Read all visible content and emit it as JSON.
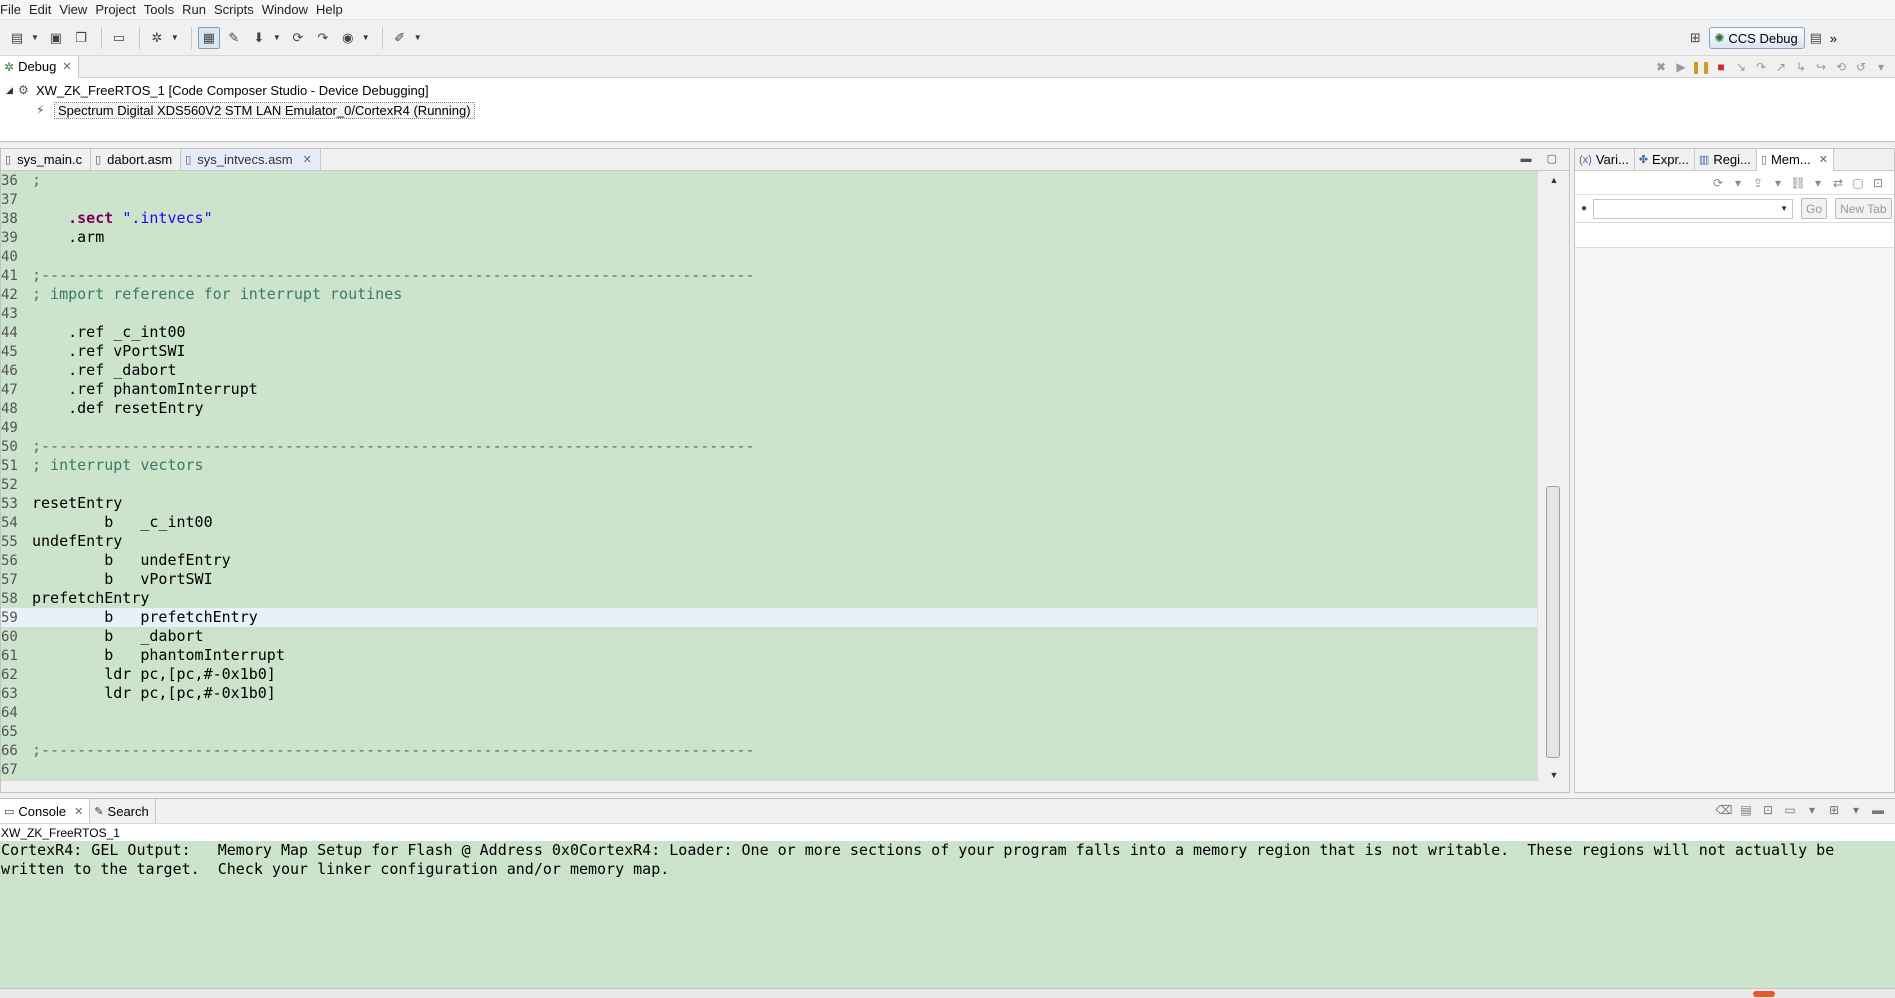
{
  "menu": [
    "File",
    "Edit",
    "View",
    "Project",
    "Tools",
    "Run",
    "Scripts",
    "Window",
    "Help"
  ],
  "toolbar": {
    "perspective_label": "CCS Debug",
    "overflow_label": "»"
  },
  "debug_view": {
    "tab_label": "Debug",
    "tree": [
      {
        "label": "XW_ZK_FreeRTOS_1 [Code Composer Studio - Device Debugging]",
        "icon": "debug-config-icon"
      },
      {
        "label": "Spectrum Digital XDS560V2 STM LAN Emulator_0/CortexR4 (Running)",
        "icon": "running-thread-icon"
      }
    ]
  },
  "editor": {
    "tabs": [
      {
        "label": "sys_main.c",
        "active": false
      },
      {
        "label": "dabort.asm",
        "active": false
      },
      {
        "label": "sys_intvecs.asm",
        "active": true
      }
    ],
    "current_line": 59,
    "lines": [
      {
        "n": "36",
        "text": ";"
      },
      {
        "n": "37",
        "text": ""
      },
      {
        "n": "38",
        "text": "    .sect \".intvecs\""
      },
      {
        "n": "39",
        "text": "    .arm"
      },
      {
        "n": "40",
        "text": ""
      },
      {
        "n": "41",
        "text": ";-------------------------------------------------------------------------------"
      },
      {
        "n": "42",
        "text": "; import reference for interrupt routines"
      },
      {
        "n": "43",
        "text": ""
      },
      {
        "n": "44",
        "text": "    .ref _c_int00"
      },
      {
        "n": "45",
        "text": "    .ref vPortSWI"
      },
      {
        "n": "46",
        "text": "    .ref _dabort"
      },
      {
        "n": "47",
        "text": "    .ref phantomInterrupt"
      },
      {
        "n": "48",
        "text": "    .def resetEntry"
      },
      {
        "n": "49",
        "text": ""
      },
      {
        "n": "50",
        "text": ";-------------------------------------------------------------------------------"
      },
      {
        "n": "51",
        "text": "; interrupt vectors"
      },
      {
        "n": "52",
        "text": ""
      },
      {
        "n": "53",
        "text": "resetEntry"
      },
      {
        "n": "54",
        "text": "        b   _c_int00"
      },
      {
        "n": "55",
        "text": "undefEntry"
      },
      {
        "n": "56",
        "text": "        b   undefEntry"
      },
      {
        "n": "57",
        "text": "        b   vPortSWI"
      },
      {
        "n": "58",
        "text": "prefetchEntry"
      },
      {
        "n": "59",
        "text": "        b   prefetchEntry"
      },
      {
        "n": "60",
        "text": "        b   _dabort"
      },
      {
        "n": "61",
        "text": "        b   phantomInterrupt"
      },
      {
        "n": "62",
        "text": "        ldr pc,[pc,#-0x1b0]"
      },
      {
        "n": "63",
        "text": "        ldr pc,[pc,#-0x1b0]"
      },
      {
        "n": "64",
        "text": ""
      },
      {
        "n": "65",
        "text": ""
      },
      {
        "n": "66",
        "text": ";-------------------------------------------------------------------------------"
      },
      {
        "n": "67",
        "text": ""
      }
    ]
  },
  "right_panel": {
    "tabs": [
      "Vari...",
      "Expr...",
      "Regi...",
      "Mem..."
    ],
    "address_placeholder": "",
    "go_label": "Go",
    "new_tab_label": "New Tab"
  },
  "console": {
    "tabs": [
      "Console",
      "Search"
    ],
    "session_name": "XW_ZK_FreeRTOS_1",
    "output": "CortexR4: GEL Output:   Memory Map Setup for Flash @ Address 0x0CortexR4: Loader: One or more sections of your program falls into a memory region that is not writable.  These regions will not actually be written to the target.  Check your linker configuration and/or memory map."
  },
  "colors": {
    "editor_background": "#cce3cc",
    "comment": "#3a7a6a",
    "keyword": "#7a0055",
    "string": "#2a00ff",
    "current_line": "#e8f0f8"
  }
}
